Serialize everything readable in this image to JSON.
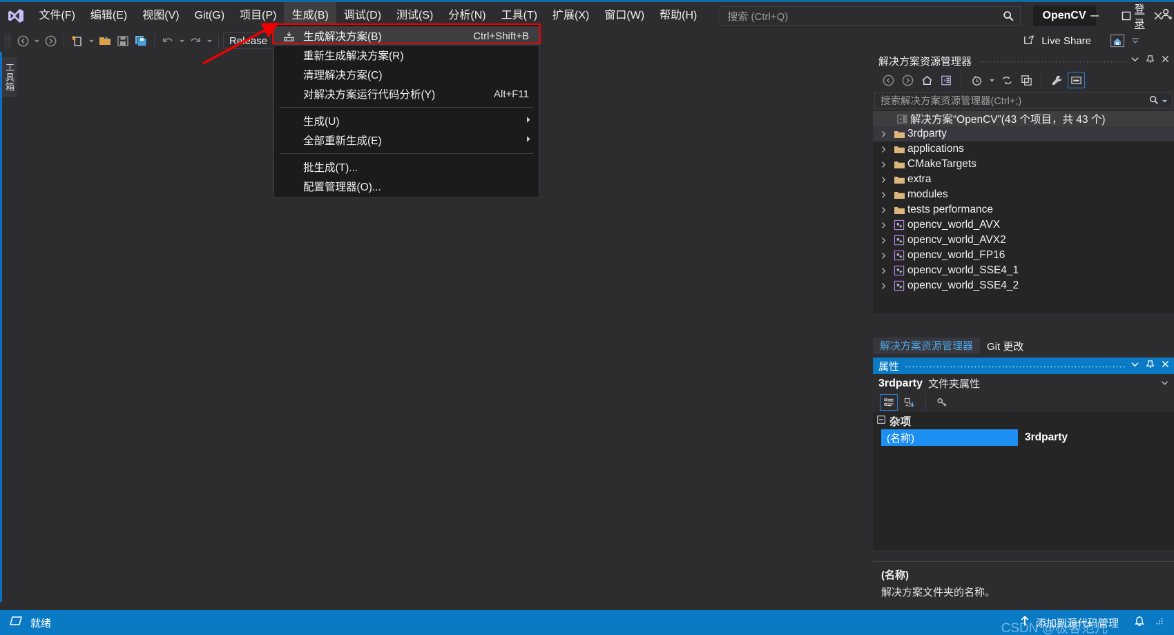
{
  "titlebar": {
    "logo_icon": "visual-studio-logo",
    "menus": [
      {
        "label": "文件(F)",
        "active": false
      },
      {
        "label": "编辑(E)",
        "active": false
      },
      {
        "label": "视图(V)",
        "active": false
      },
      {
        "label": "Git(G)",
        "active": false
      },
      {
        "label": "项目(P)",
        "active": false
      },
      {
        "label": "生成(B)",
        "active": true
      },
      {
        "label": "调试(D)",
        "active": false
      },
      {
        "label": "测试(S)",
        "active": false
      },
      {
        "label": "分析(N)",
        "active": false
      },
      {
        "label": "工具(T)",
        "active": false
      },
      {
        "label": "扩展(X)",
        "active": false
      },
      {
        "label": "窗口(W)",
        "active": false
      },
      {
        "label": "帮助(H)",
        "active": false
      }
    ],
    "search_placeholder": "搜索 (Ctrl+Q)",
    "search_icon": "search-icon",
    "solution_chip": "OpenCV",
    "signin_label": "登录",
    "signin_icon": "person-add-icon",
    "minimize_icon": "minimize-icon",
    "maximize_icon": "maximize-icon",
    "close_icon": "close-icon"
  },
  "toolbar": {
    "back_icon": "navigate-back-icon",
    "forward_icon": "navigate-forward-icon",
    "new_item_icon": "new-item-icon",
    "open_icon": "open-file-icon",
    "save_icon": "save-icon",
    "save_all_icon": "save-all-icon",
    "undo_icon": "undo-icon",
    "redo_icon": "redo-icon",
    "configuration": "Release",
    "home_icon": "home-icon",
    "liveshare_label": "Live Share",
    "liveshare_icon": "live-share-icon",
    "feedback_icon": "feedback-icon"
  },
  "left_rail": {
    "toolbox_label": "工具箱"
  },
  "build_menu": {
    "items": [
      {
        "label": "生成解决方案(B)",
        "shortcut": "Ctrl+Shift+B",
        "icon": "build-solution-icon",
        "highlighted": true,
        "submenu": false,
        "separator_after": false
      },
      {
        "label": "重新生成解决方案(R)",
        "shortcut": "",
        "icon": "",
        "highlighted": false,
        "submenu": false,
        "separator_after": false
      },
      {
        "label": "清理解决方案(C)",
        "shortcut": "",
        "icon": "",
        "highlighted": false,
        "submenu": false,
        "separator_after": false
      },
      {
        "label": "对解决方案运行代码分析(Y)",
        "shortcut": "Alt+F11",
        "icon": "",
        "highlighted": false,
        "submenu": false,
        "separator_after": true
      },
      {
        "label": "生成(U)",
        "shortcut": "",
        "icon": "",
        "highlighted": false,
        "submenu": true,
        "separator_after": false
      },
      {
        "label": "全部重新生成(E)",
        "shortcut": "",
        "icon": "",
        "highlighted": false,
        "submenu": true,
        "separator_after": true
      },
      {
        "label": "批生成(T)...",
        "shortcut": "",
        "icon": "",
        "highlighted": false,
        "submenu": false,
        "separator_after": false
      },
      {
        "label": "配置管理器(O)...",
        "shortcut": "",
        "icon": "",
        "highlighted": false,
        "submenu": false,
        "separator_after": false
      }
    ],
    "annotation_color": "#f00000"
  },
  "solution_explorer": {
    "title": "解决方案资源管理器",
    "header_buttons": [
      "chevron-down-icon",
      "pin-icon",
      "close-icon"
    ],
    "toolbar_icons": [
      "back-icon",
      "forward-icon",
      "home-icon",
      "solution-root-icon",
      "pending-changes-icon",
      "refresh-icon",
      "collapse-all-icon",
      "properties-wrench-icon",
      "preview-selected-items-icon"
    ],
    "search_placeholder": "搜索解决方案资源管理器(Ctrl+;)",
    "search_icon": "search-icon",
    "search_dropdown_icon": "chevron-down-icon",
    "root": {
      "label": "解决方案“OpenCV”(43 个项目，共 43 个)",
      "icon": "solution-icon"
    },
    "nodes": [
      {
        "label": "3rdparty",
        "icon": "folder-icon",
        "selected": true
      },
      {
        "label": "applications",
        "icon": "folder-icon",
        "selected": false
      },
      {
        "label": "CMakeTargets",
        "icon": "folder-icon",
        "selected": false
      },
      {
        "label": "extra",
        "icon": "folder-icon",
        "selected": false
      },
      {
        "label": "modules",
        "icon": "folder-icon",
        "selected": false
      },
      {
        "label": "tests performance",
        "icon": "folder-icon",
        "selected": false
      },
      {
        "label": "opencv_world_AVX",
        "icon": "cpp-project-icon",
        "selected": false
      },
      {
        "label": "opencv_world_AVX2",
        "icon": "cpp-project-icon",
        "selected": false
      },
      {
        "label": "opencv_world_FP16",
        "icon": "cpp-project-icon",
        "selected": false
      },
      {
        "label": "opencv_world_SSE4_1",
        "icon": "cpp-project-icon",
        "selected": false
      },
      {
        "label": "opencv_world_SSE4_2",
        "icon": "cpp-project-icon",
        "selected": false
      }
    ],
    "dock_tabs": [
      {
        "label": "解决方案资源管理器",
        "active": true
      },
      {
        "label": "Git 更改",
        "active": false
      }
    ]
  },
  "properties": {
    "title": "属性",
    "header_buttons": [
      "chevron-down-icon",
      "pin-icon",
      "close-icon"
    ],
    "object_name": "3rdparty",
    "object_type": "文件夹属性",
    "object_caret_icon": "chevron-down-icon",
    "toolbar_icons": [
      "categorized-icon",
      "alphabetical-sort-icon",
      "property-pages-key-icon"
    ],
    "group_label": "杂项",
    "group_expander_icon": "minus-box-icon",
    "rows": [
      {
        "key": "(名称)",
        "value": "3rdparty",
        "selected": true
      }
    ],
    "desc_title": "(名称)",
    "desc_body": "解决方案文件夹的名称。"
  },
  "statusbar": {
    "ready_label": "就绪",
    "ready_icon": "ready-flag-icon",
    "source_control_label": "添加到源代码管理",
    "source_control_icon": "up-arrow-icon",
    "notify_icon": "bell-icon",
    "resize_grip_icon": "resize-grip-icon",
    "watermark": "CSDN @极客范儿"
  },
  "colors": {
    "accent_blue": "#0a7ac4",
    "menu_highlight": "#3e3e40",
    "annotation_red": "#f00000",
    "selection_blue": "#1d8ef2",
    "chrome_bg": "#2d2d30",
    "panel_bg": "#252526"
  }
}
